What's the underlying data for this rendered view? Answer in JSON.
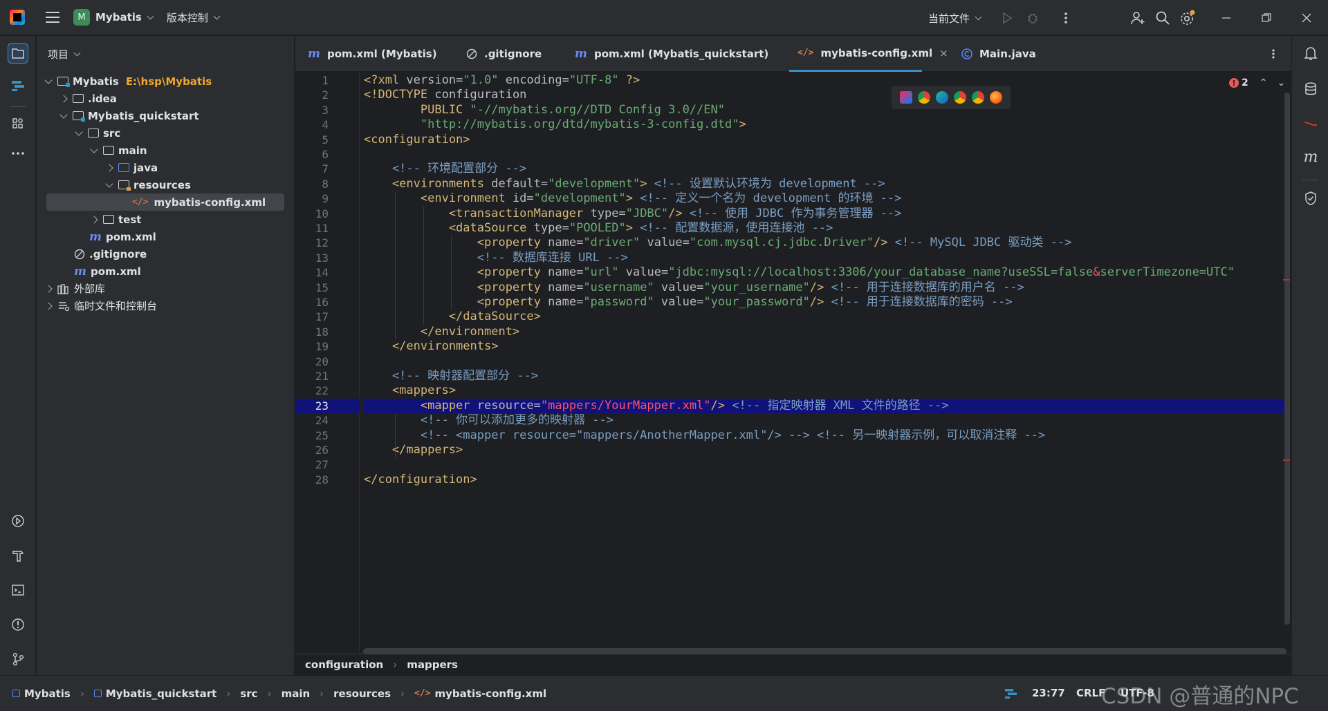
{
  "titlebar": {
    "project_badge": "M",
    "project_name": "Mybatis",
    "vcs_label": "版本控制",
    "run_config": "当前文件"
  },
  "project_panel": {
    "title": "项目",
    "tree": [
      {
        "label": "Mybatis",
        "path": "E:\\hsp\\Mybatis"
      },
      {
        "label": ".idea"
      },
      {
        "label": "Mybatis_quickstart"
      },
      {
        "label": "src"
      },
      {
        "label": "main"
      },
      {
        "label": "java"
      },
      {
        "label": "resources"
      },
      {
        "label": "mybatis-config.xml"
      },
      {
        "label": "test"
      },
      {
        "label": "pom.xml"
      },
      {
        "label": ".gitignore"
      },
      {
        "label": "pom.xml"
      },
      {
        "label": "外部库"
      },
      {
        "label": "临时文件和控制台"
      }
    ]
  },
  "tabs": [
    {
      "label": "pom.xml (Mybatis)",
      "icon": "maven-icon"
    },
    {
      "label": ".gitignore",
      "icon": "ignore-icon"
    },
    {
      "label": "pom.xml (Mybatis_quickstart)",
      "icon": "maven-icon"
    },
    {
      "label": "mybatis-config.xml",
      "icon": "xml-icon",
      "active": true
    },
    {
      "label": "Main.java",
      "icon": "java-class-icon"
    }
  ],
  "editor": {
    "error_count": "2",
    "current_line": 23,
    "line_numbers": [
      "1",
      "2",
      "3",
      "4",
      "5",
      "6",
      "7",
      "8",
      "9",
      "10",
      "11",
      "12",
      "13",
      "14",
      "15",
      "16",
      "17",
      "18",
      "19",
      "20",
      "21",
      "22",
      "23",
      "24",
      "25",
      "26",
      "27",
      "28"
    ],
    "lines": [
      [
        [
          "t-tag",
          "<?xml "
        ],
        [
          "t-attr",
          "version"
        ],
        [
          "t-txt",
          "="
        ],
        [
          "t-val",
          "\"1.0\""
        ],
        [
          "t-txt",
          " "
        ],
        [
          "t-attr",
          "encoding"
        ],
        [
          "t-txt",
          "="
        ],
        [
          "t-val",
          "\"UTF-8\""
        ],
        [
          "t-tag",
          " ?>"
        ]
      ],
      [
        [
          "t-tag",
          "<!DOCTYPE "
        ],
        [
          "t-txt",
          "configuration"
        ]
      ],
      [
        [
          "t-tag",
          "        PUBLIC "
        ],
        [
          "t-val",
          "\"-//mybatis.org//DTD Config 3.0//EN\""
        ]
      ],
      [
        [
          "t-val",
          "        \"http://mybatis.org/dtd/mybatis-3-config.dtd\""
        ],
        [
          "t-tag",
          ">"
        ]
      ],
      [
        [
          "t-tag",
          "<configuration>"
        ]
      ],
      [],
      [
        [
          "t-cmt",
          "    <!-- 环境配置部分 -->"
        ]
      ],
      [
        [
          "t-tag",
          "    <environments "
        ],
        [
          "t-attr",
          "default"
        ],
        [
          "t-txt",
          "="
        ],
        [
          "t-val",
          "\"development\""
        ],
        [
          "t-tag",
          ">"
        ],
        [
          "t-cmt",
          " <!-- 设置默认环境为 development -->"
        ]
      ],
      [
        [
          "t-tag",
          "        <environment "
        ],
        [
          "t-attr",
          "id"
        ],
        [
          "t-txt",
          "="
        ],
        [
          "t-val",
          "\"development\""
        ],
        [
          "t-tag",
          ">"
        ],
        [
          "t-cmt",
          " <!-- 定义一个名为 development 的环境 -->"
        ]
      ],
      [
        [
          "t-tag",
          "            <transactionManager "
        ],
        [
          "t-attr",
          "type"
        ],
        [
          "t-txt",
          "="
        ],
        [
          "t-val",
          "\"JDBC\""
        ],
        [
          "t-tag",
          "/>"
        ],
        [
          "t-cmt",
          " <!-- 使用 JDBC 作为事务管理器 -->"
        ]
      ],
      [
        [
          "t-tag",
          "            <dataSource "
        ],
        [
          "t-attr",
          "type"
        ],
        [
          "t-txt",
          "="
        ],
        [
          "t-val",
          "\"POOLED\""
        ],
        [
          "t-tag",
          ">"
        ],
        [
          "t-cmt",
          " <!-- 配置数据源，使用连接池 -->"
        ]
      ],
      [
        [
          "t-tag",
          "                <property "
        ],
        [
          "t-attr",
          "name"
        ],
        [
          "t-txt",
          "="
        ],
        [
          "t-val",
          "\"driver\""
        ],
        [
          "t-txt",
          " "
        ],
        [
          "t-attr",
          "value"
        ],
        [
          "t-txt",
          "="
        ],
        [
          "t-val",
          "\"com.mysql.cj.jdbc.Driver\""
        ],
        [
          "t-tag",
          "/>"
        ],
        [
          "t-cmt",
          " <!-- MySQL JDBC 驱动类 -->"
        ]
      ],
      [
        [
          "t-cmt",
          "                <!-- 数据库连接 URL -->"
        ]
      ],
      [
        [
          "t-tag",
          "                <property "
        ],
        [
          "t-attr",
          "name"
        ],
        [
          "t-txt",
          "="
        ],
        [
          "t-val",
          "\"url\""
        ],
        [
          "t-txt",
          " "
        ],
        [
          "t-attr",
          "value"
        ],
        [
          "t-txt",
          "="
        ],
        [
          "t-val",
          "\"jdbc:mysql://localhost:3306/your_database_name?useSSL=false"
        ],
        [
          "t-red",
          "&"
        ],
        [
          "t-val",
          "serverTimezone=UTC\""
        ]
      ],
      [
        [
          "t-tag",
          "                <property "
        ],
        [
          "t-attr",
          "name"
        ],
        [
          "t-txt",
          "="
        ],
        [
          "t-val",
          "\"username\""
        ],
        [
          "t-txt",
          " "
        ],
        [
          "t-attr",
          "value"
        ],
        [
          "t-txt",
          "="
        ],
        [
          "t-val",
          "\"your_username\""
        ],
        [
          "t-tag",
          "/>"
        ],
        [
          "t-cmt",
          " <!-- 用于连接数据库的用户名 -->"
        ]
      ],
      [
        [
          "t-tag",
          "                <property "
        ],
        [
          "t-attr",
          "name"
        ],
        [
          "t-txt",
          "="
        ],
        [
          "t-val",
          "\"password\""
        ],
        [
          "t-txt",
          " "
        ],
        [
          "t-attr",
          "value"
        ],
        [
          "t-txt",
          "="
        ],
        [
          "t-val",
          "\"your_password\""
        ],
        [
          "t-tag",
          "/>"
        ],
        [
          "t-cmt",
          " <!-- 用于连接数据库的密码 -->"
        ]
      ],
      [
        [
          "t-tag",
          "            </dataSource>"
        ]
      ],
      [
        [
          "t-tag",
          "        </environment>"
        ]
      ],
      [
        [
          "t-tag",
          "    </environments>"
        ]
      ],
      [],
      [
        [
          "t-cmt",
          "    <!-- 映射器配置部分 -->"
        ]
      ],
      [
        [
          "t-tag",
          "    <mappers>"
        ]
      ],
      [
        [
          "t-tag",
          "        <mapper "
        ],
        [
          "t-attr",
          "resource"
        ],
        [
          "t-txt",
          "="
        ],
        [
          "t-red",
          "\"mappers/YourMapper.xml\""
        ],
        [
          "t-tag",
          "/>"
        ],
        [
          "t-cmt",
          " <!-- 指定映射器 XML 文件的路径 -->"
        ]
      ],
      [
        [
          "t-cmt",
          "        <!-- 你可以添加更多的映射器 -->"
        ]
      ],
      [
        [
          "t-cmt",
          "        <!-- <mapper resource=\"mappers/AnotherMapper.xml\"/> --> <!-- 另一映射器示例，可以取消注释 -->"
        ]
      ],
      [
        [
          "t-tag",
          "    </mappers>"
        ]
      ],
      [],
      [
        [
          "t-tag",
          "</configuration>"
        ]
      ]
    ]
  },
  "breadcrumbs": [
    "configuration",
    "mappers"
  ],
  "statusbar": {
    "path": [
      "Mybatis",
      "Mybatis_quickstart",
      "src",
      "main",
      "resources",
      "mybatis-config.xml"
    ],
    "cursor_pos": "23:77",
    "line_sep": "CRLF",
    "encoding": "UTF-8"
  },
  "watermark": "CSDN @普通的NPC",
  "colors": {
    "accent": "#3592c4",
    "error": "#e55b5b",
    "current_line_bg": "#11117a"
  }
}
